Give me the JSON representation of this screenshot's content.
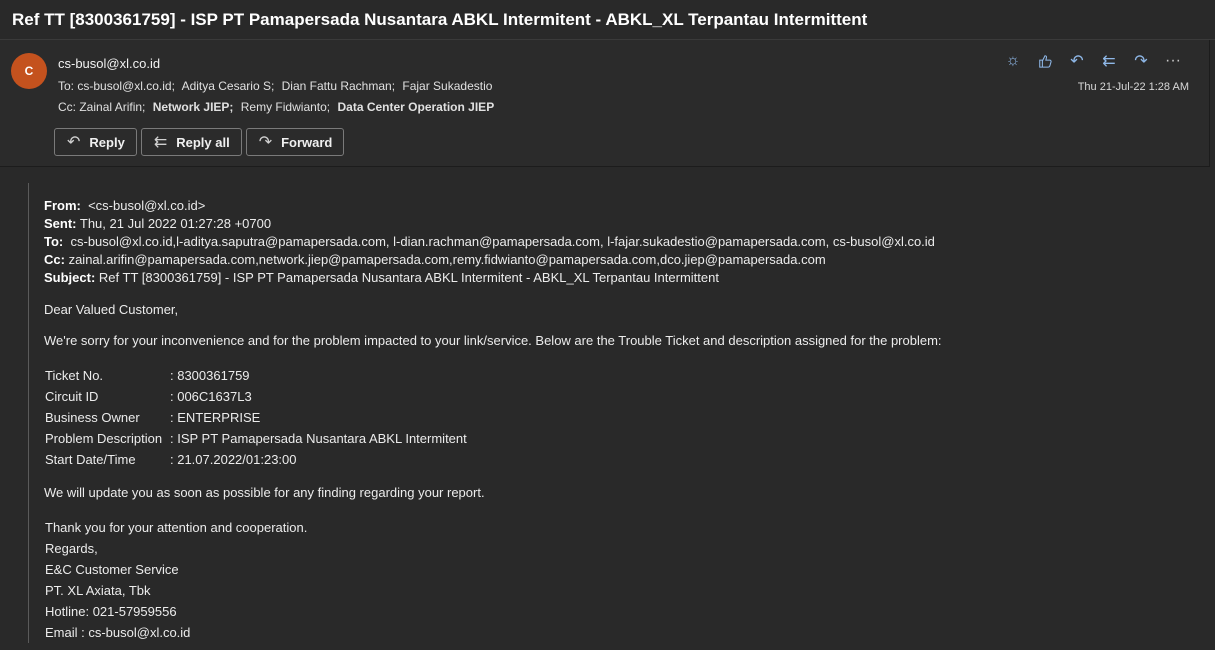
{
  "subject": "Ref TT [8300361759] - ISP PT Pamapersada Nusantara ABKL Intermitent - ABKL_XL Terpantau Intermittent",
  "header": {
    "avatar_initial": "C",
    "sender": "cs-busol@xl.co.id",
    "to_label": "To:",
    "to": [
      "cs-busol@xl.co.id;",
      "Aditya Cesario S;",
      "Dian Fattu Rachman;",
      "Fajar Sukadestio"
    ],
    "cc_label": "Cc:",
    "cc": [
      "Zainal Arifin;",
      "Network JIEP;",
      "Remy Fidwianto;",
      "Data Center Operation JIEP"
    ],
    "date": "Thu 21-Jul-22 1:28 AM",
    "icons": [
      "sun-icon",
      "thumbs-up-icon",
      "reply-icon",
      "reply-all-icon",
      "forward-icon",
      "more-icon"
    ]
  },
  "buttons": {
    "reply": "Reply",
    "reply_all": "Reply all",
    "forward": "Forward"
  },
  "message": {
    "from_label": "From:",
    "from": "<cs-busol@xl.co.id>",
    "sent_label": "Sent:",
    "sent": "Thu, 21 Jul 2022 01:27:28 +0700",
    "to_label": "To:",
    "to": "cs-busol@xl.co.id,l-aditya.saputra@pamapersada.com, l-dian.rachman@pamapersada.com, l-fajar.sukadestio@pamapersada.com, cs-busol@xl.co.id",
    "cc_label": "Cc:",
    "cc": "zainal.arifin@pamapersada.com,network.jiep@pamapersada.com,remy.fidwianto@pamapersada.com,dco.jiep@pamapersada.com",
    "subject_label": "Subject:",
    "subject": "Ref TT [8300361759] - ISP PT Pamapersada Nusantara ABKL Intermitent - ABKL_XL Terpantau Intermittent",
    "greeting": "Dear Valued Customer,",
    "intro": "We're sorry for your inconvenience and for the problem impacted to your link/service. Below are the Trouble Ticket and description assigned for the problem:",
    "ticket": [
      {
        "label": "Ticket No.",
        "value": ": 8300361759"
      },
      {
        "label": "Circuit ID",
        "value": ": 006C1637L3"
      },
      {
        "label": "Business Owner",
        "value": ": ENTERPRISE"
      },
      {
        "label": "Problem Description",
        "value": ": ISP PT Pamapersada Nusantara ABKL Intermitent"
      },
      {
        "label": "Start Date/Time",
        "value": ": 21.07.2022/01:23:00"
      }
    ],
    "update": "We will update you as soon as possible for any finding regarding your report.",
    "signature": [
      "Thank you for your attention and cooperation.",
      "Regards,",
      "E&C Customer Service",
      "PT. XL Axiata, Tbk",
      "Hotline: 021-57959556",
      "Email : cs-busol@xl.co.id"
    ]
  }
}
